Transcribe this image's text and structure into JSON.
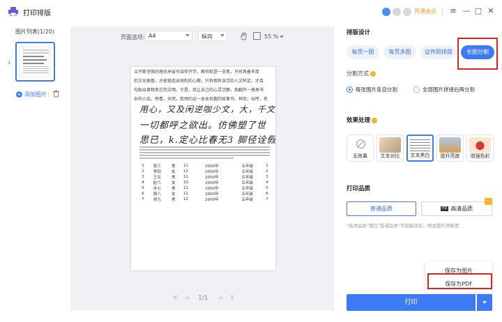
{
  "app": {
    "title": "打印排版"
  },
  "header": {
    "vip_label": "开通会员",
    "menu_icon": "hamburger",
    "minimize": "—",
    "maximize": "□",
    "close": "✕"
  },
  "sidebar": {
    "title": "图片列表(1/20)",
    "thumb_index": "1",
    "add_label": "添加图片"
  },
  "toolbar": {
    "page_option_label": "页面选项:",
    "paper_size": "A4",
    "orientation": "纵向",
    "zoom": "55 %"
  },
  "document": {
    "print_lines": [
      "以不断坚强的理念来省写结伴开学，教师就是一支笔，只有具备丰厚",
      "的文化根基，才能锻造出锐利的心魄，只有拥有深沉的人文积淀，才会",
      "勾勒出事物变迁的文明。于是，我让自己的心灵沉静，我翻开一册册书",
      "永的小品，旁看，天然，我预约这一本本有趣的故事书。神奇；似呼，有"
    ],
    "handwriting": [
      "用心，又及闲逆咖少文，大，千文，",
      "一切都呼之欲出。仿佛塑了世",
      "思已，k.定心比春无3 脚径诠假"
    ],
    "table_rows": [
      [
        "1",
        "张三",
        "男",
        "11",
        "2000年",
        "五年级",
        "1"
      ],
      [
        "2",
        "李四",
        "女",
        "12",
        "2000年",
        "五年级",
        "2"
      ],
      [
        "3",
        "王五",
        "男",
        "11",
        "2000年",
        "五年级",
        "3"
      ],
      [
        "4",
        "赵六",
        "女",
        "10",
        "2000年",
        "五年级",
        "4"
      ],
      [
        "5",
        "孙七",
        "男",
        "11",
        "2000年",
        "五年级",
        "5"
      ],
      [
        "6",
        "周八",
        "女",
        "11",
        "2000年",
        "五年级",
        "6"
      ],
      [
        "7",
        "吴九",
        "男",
        "12",
        "2000年",
        "五年级",
        "7"
      ]
    ]
  },
  "pager": {
    "first": "K",
    "prev": "<",
    "page": "1/1",
    "next": ">",
    "last": "X"
  },
  "panel": {
    "layout_title": "排版设计",
    "layout_modes": [
      "每页一图",
      "每页多图",
      "证件照排版",
      "长图分割"
    ],
    "split_title": "分割方式",
    "split_options": [
      "每张图片各自分割",
      "全部图片拼接后再分割"
    ],
    "effect_title": "效果处理",
    "effects": [
      "无效果",
      "文本对比",
      "文本黑白",
      "提升亮度",
      "增强色彩"
    ],
    "quality_title": "打印品质",
    "quality_options": [
      "普通品质",
      "高清品质"
    ],
    "hd_tag": "HD",
    "quality_note": "\"高清品质\"相比\"普通品质\"可智能优化，明显提升清晰度",
    "save_menu": [
      "保存为图片",
      "保存为PDF"
    ],
    "print_label": "打印"
  },
  "colors": {
    "accent": "#3d7af5",
    "highlight": "#e21f1f",
    "vip": "#f09a1a",
    "warning": "#f1b52e"
  }
}
